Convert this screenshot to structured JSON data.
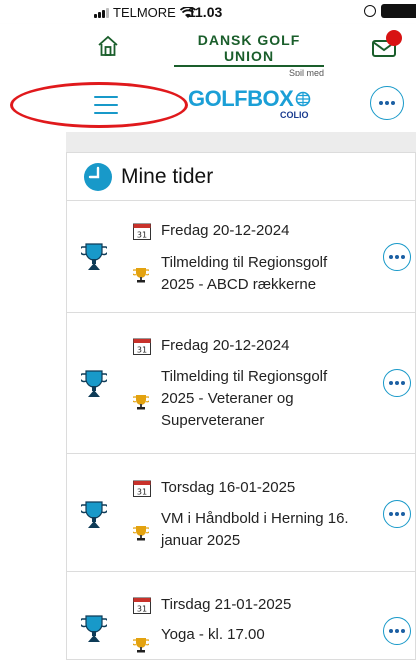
{
  "status_bar": {
    "carrier": "TELMORE",
    "time": "11.03"
  },
  "dgu": {
    "logo_text": "DANSK GOLF UNION",
    "tagline": "Spil med"
  },
  "golfbox": {
    "logo_text": "GOLFBOX",
    "sub_logo": "COLIO"
  },
  "panel": {
    "title": "Mine tider"
  },
  "entries": [
    {
      "date": "Fredag 20-12-2024",
      "title": "Tilmelding til Regionsgolf 2025 - ABCD rækkerne"
    },
    {
      "date": "Fredag 20-12-2024",
      "title": "Tilmelding til Regionsgolf 2025 - Veteraner og Superveteraner"
    },
    {
      "date": "Torsdag 16-01-2025",
      "title": "VM i Håndbold i Herning 16. januar 2025"
    },
    {
      "date": "Tirsdag 21-01-2025",
      "title": "Yoga - kl. 17.00"
    }
  ],
  "icons": {
    "home": "home-icon",
    "mail": "mail-icon",
    "menu": "hamburger-icon",
    "more": "more-icon",
    "clock": "clock-icon",
    "calendar": "calendar-icon",
    "trophy": "trophy-icon",
    "cup": "cup-icon"
  },
  "colors": {
    "accent": "#1899c9",
    "dgu_green": "#1a5e2b",
    "notification": "#d81313",
    "annotation": "#e0191c",
    "cup": "#e3a20f"
  }
}
